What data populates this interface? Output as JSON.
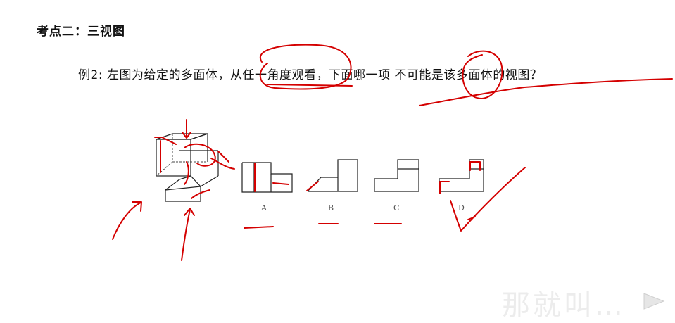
{
  "title": "考点二：三视图",
  "question": "例2:  左图为给定的多面体，从任一角度观看，下面哪一项 不可能是该多面体的视图？",
  "options": [
    "A",
    "B",
    "C",
    "D"
  ],
  "watermark": "那就叫…",
  "colors": {
    "ink": "#d40000",
    "text": "#111111"
  },
  "icons": [
    "play-icon"
  ]
}
